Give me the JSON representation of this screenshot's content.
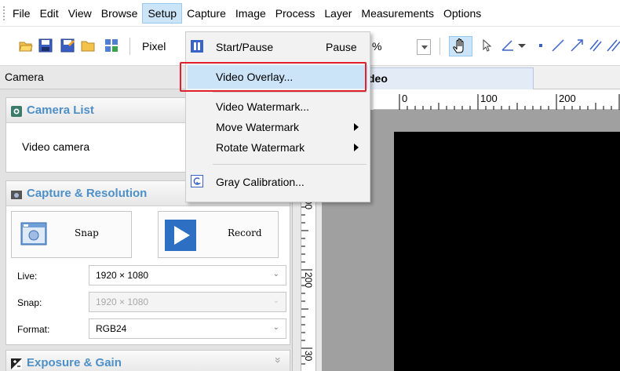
{
  "menubar": {
    "items": [
      "File",
      "Edit",
      "View",
      "Browse",
      "Setup",
      "Capture",
      "Image",
      "Process",
      "Layer",
      "Measurements",
      "Options"
    ],
    "active": "Setup"
  },
  "toolbar": {
    "unit_label": "Pixel",
    "zoom_fragment": "%"
  },
  "left_panel": {
    "header": "Camera",
    "camera_list": {
      "title": "Camera List",
      "items": [
        "Video camera"
      ]
    },
    "capture": {
      "title": "Capture & Resolution",
      "snap_label": "Snap",
      "record_label": "Record",
      "live_label": "Live:",
      "live_value": "1920 × 1080",
      "snap_res_label": "Snap:",
      "snap_res_value": "1920 × 1080",
      "format_label": "Format:",
      "format_value": "RGB24"
    },
    "exposure": {
      "title": "Exposure & Gain",
      "collapse_glyph": "»"
    }
  },
  "document": {
    "tab_label": "deo",
    "h_ruler": [
      "0",
      "100",
      "200"
    ],
    "v_ruler": [
      "100",
      "200",
      "30"
    ]
  },
  "setup_menu": {
    "start_pause": {
      "label": "Start/Pause",
      "accel": "Pause"
    },
    "video_overlay": "Video Overlay...",
    "video_watermark": "Video Watermark...",
    "move_watermark": "Move Watermark",
    "rotate_watermark": "Rotate Watermark",
    "gray_calibration": "Gray Calibration..."
  },
  "colors": {
    "highlight": "#cce4f7",
    "callout": "#e0202a",
    "section_title": "#4d8fc7"
  }
}
